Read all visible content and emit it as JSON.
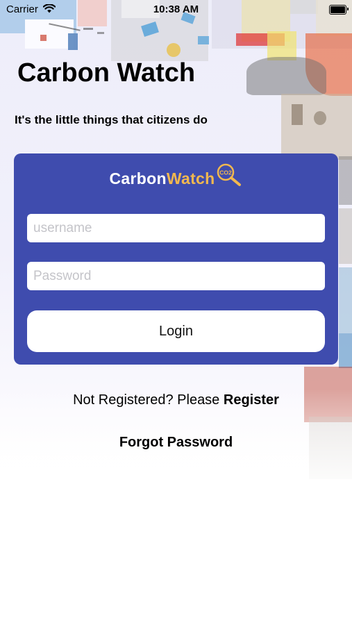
{
  "status_bar": {
    "carrier": "Carrier",
    "time": "10:38 AM"
  },
  "header": {
    "title": "Carbon Watch",
    "tagline": "It's the little things that citizens do"
  },
  "logo": {
    "part1": "Carbon",
    "part2": "Watch",
    "badge": "CO2",
    "accent_color": "#f2b84f"
  },
  "form": {
    "username_placeholder": "username",
    "password_placeholder": "Password",
    "login_label": "Login",
    "card_color": "#3f4cae"
  },
  "footer": {
    "register_prompt": "Not Registered? Please ",
    "register_link": "Register",
    "forgot_password": "Forgot Password"
  }
}
